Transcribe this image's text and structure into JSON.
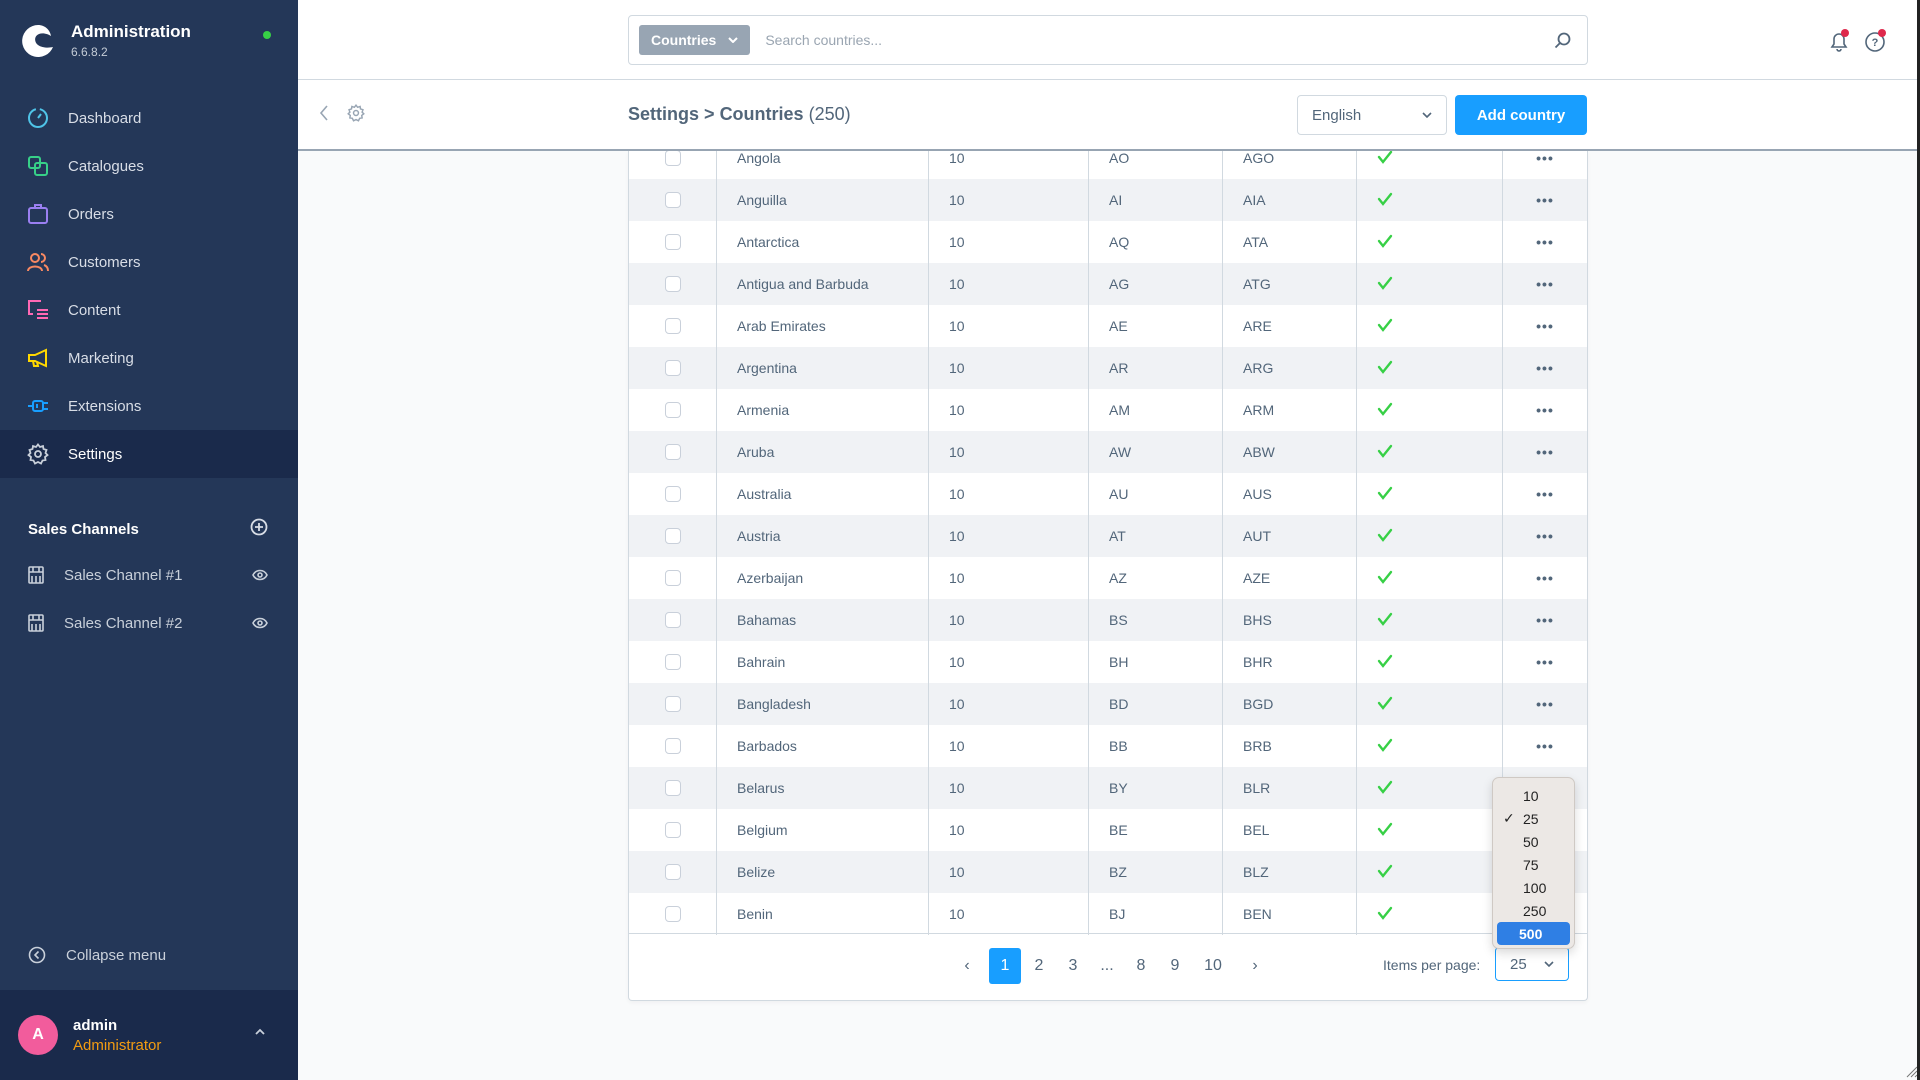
{
  "app": {
    "title": "Administration",
    "version": "6.6.8.2",
    "status_color": "#37d046"
  },
  "sidebar": {
    "items": [
      {
        "label": "Dashboard",
        "icon": "dashboard-icon",
        "color": "#4fc4e8"
      },
      {
        "label": "Catalogues",
        "icon": "catalogues-icon",
        "color": "#37d088"
      },
      {
        "label": "Orders",
        "icon": "orders-icon",
        "color": "#9a7ff1"
      },
      {
        "label": "Customers",
        "icon": "customers-icon",
        "color": "#f88962"
      },
      {
        "label": "Content",
        "icon": "content-icon",
        "color": "#ff68b4"
      },
      {
        "label": "Marketing",
        "icon": "marketing-icon",
        "color": "#ffd700"
      },
      {
        "label": "Extensions",
        "icon": "extensions-icon",
        "color": "#189eff"
      },
      {
        "label": "Settings",
        "icon": "settings-icon",
        "color": "#c9d0da",
        "active": true
      }
    ],
    "sales_channels": {
      "title": "Sales Channels",
      "items": [
        {
          "label": "Sales Channel #1"
        },
        {
          "label": "Sales Channel #2"
        }
      ]
    },
    "collapse_label": "Collapse menu",
    "user": {
      "initial": "A",
      "name": "admin",
      "role": "Administrator"
    }
  },
  "search": {
    "type_label": "Countries",
    "placeholder": "Search countries...",
    "value": ""
  },
  "smartbar": {
    "breadcrumb_parent": "Settings",
    "separator": ">",
    "title": "Countries",
    "count": "(250)",
    "language": "English",
    "add_button": "Add country"
  },
  "table": {
    "rows": [
      {
        "name": "Angola",
        "position": "10",
        "iso": "AO",
        "iso3": "AGO",
        "active": true
      },
      {
        "name": "Anguilla",
        "position": "10",
        "iso": "AI",
        "iso3": "AIA",
        "active": true
      },
      {
        "name": "Antarctica",
        "position": "10",
        "iso": "AQ",
        "iso3": "ATA",
        "active": true
      },
      {
        "name": "Antigua and Barbuda",
        "position": "10",
        "iso": "AG",
        "iso3": "ATG",
        "active": true
      },
      {
        "name": "Arab Emirates",
        "position": "10",
        "iso": "AE",
        "iso3": "ARE",
        "active": true
      },
      {
        "name": "Argentina",
        "position": "10",
        "iso": "AR",
        "iso3": "ARG",
        "active": true
      },
      {
        "name": "Armenia",
        "position": "10",
        "iso": "AM",
        "iso3": "ARM",
        "active": true
      },
      {
        "name": "Aruba",
        "position": "10",
        "iso": "AW",
        "iso3": "ABW",
        "active": true
      },
      {
        "name": "Australia",
        "position": "10",
        "iso": "AU",
        "iso3": "AUS",
        "active": true
      },
      {
        "name": "Austria",
        "position": "10",
        "iso": "AT",
        "iso3": "AUT",
        "active": true
      },
      {
        "name": "Azerbaijan",
        "position": "10",
        "iso": "AZ",
        "iso3": "AZE",
        "active": true
      },
      {
        "name": "Bahamas",
        "position": "10",
        "iso": "BS",
        "iso3": "BHS",
        "active": true
      },
      {
        "name": "Bahrain",
        "position": "10",
        "iso": "BH",
        "iso3": "BHR",
        "active": true
      },
      {
        "name": "Bangladesh",
        "position": "10",
        "iso": "BD",
        "iso3": "BGD",
        "active": true
      },
      {
        "name": "Barbados",
        "position": "10",
        "iso": "BB",
        "iso3": "BRB",
        "active": true
      },
      {
        "name": "Belarus",
        "position": "10",
        "iso": "BY",
        "iso3": "BLR",
        "active": true
      },
      {
        "name": "Belgium",
        "position": "10",
        "iso": "BE",
        "iso3": "BEL",
        "active": true
      },
      {
        "name": "Belize",
        "position": "10",
        "iso": "BZ",
        "iso3": "BLZ",
        "active": true
      },
      {
        "name": "Benin",
        "position": "10",
        "iso": "BJ",
        "iso3": "BEN",
        "active": true
      }
    ],
    "menu_glyph": "•••",
    "check_color": "#37d046"
  },
  "pagination": {
    "prev": "‹",
    "next": "›",
    "pages": [
      "1",
      "2",
      "3",
      "...",
      "8",
      "9",
      "10"
    ],
    "current": "1",
    "items_per_page_label": "Items per page:",
    "items_per_page": "25"
  },
  "per_page_dropdown": {
    "options": [
      "10",
      "25",
      "50",
      "75",
      "100",
      "250",
      "500"
    ],
    "selected": "25",
    "highlighted": "500",
    "check_glyph": "✓"
  }
}
